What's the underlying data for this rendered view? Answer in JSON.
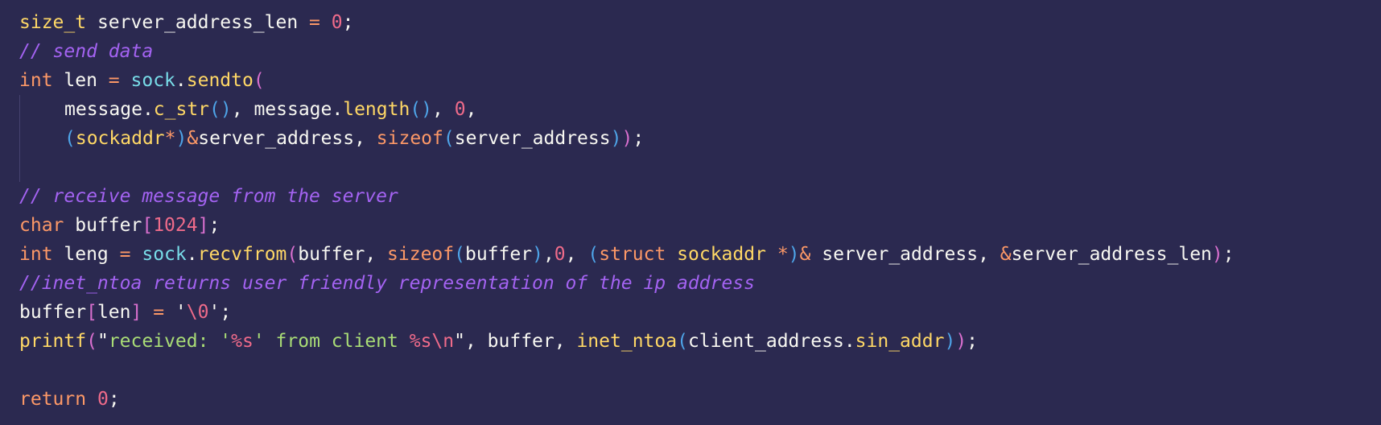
{
  "colors": {
    "background": "#2b2950",
    "default": "#f8f8f2",
    "type": "#ffd866",
    "keyword": "#fc9867",
    "number": "#ef6b8a",
    "comment": "#a463f2",
    "object": "#78dce8",
    "function": "#ffd866",
    "paren_outer": "#d86fce",
    "paren_inner": "#4ea4e8",
    "string": "#a9dc76",
    "escape": "#ef6b8a",
    "indent_guide": "#45426e"
  },
  "lines": [
    {
      "tokens": [
        {
          "t": "size_t",
          "c": "type"
        },
        {
          "t": " server_address_len ",
          "c": "default"
        },
        {
          "t": "=",
          "c": "keyword"
        },
        {
          "t": " ",
          "c": "default"
        },
        {
          "t": "0",
          "c": "number"
        },
        {
          "t": ";",
          "c": "default"
        }
      ]
    },
    {
      "comment": true,
      "tokens": [
        {
          "t": "// send data",
          "c": "comment"
        }
      ]
    },
    {
      "tokens": [
        {
          "t": "int",
          "c": "keyword"
        },
        {
          "t": " len ",
          "c": "default"
        },
        {
          "t": "=",
          "c": "keyword"
        },
        {
          "t": " ",
          "c": "default"
        },
        {
          "t": "sock",
          "c": "object"
        },
        {
          "t": ".",
          "c": "default"
        },
        {
          "t": "sendto",
          "c": "function"
        },
        {
          "t": "(",
          "c": "paren_outer"
        }
      ]
    },
    {
      "indent": true,
      "tokens": [
        {
          "t": "message",
          "c": "default"
        },
        {
          "t": ".",
          "c": "default"
        },
        {
          "t": "c_str",
          "c": "function"
        },
        {
          "t": "()",
          "c": "paren_inner"
        },
        {
          "t": ", message",
          "c": "default"
        },
        {
          "t": ".",
          "c": "default"
        },
        {
          "t": "length",
          "c": "function"
        },
        {
          "t": "()",
          "c": "paren_inner"
        },
        {
          "t": ", ",
          "c": "default"
        },
        {
          "t": "0",
          "c": "number"
        },
        {
          "t": ",",
          "c": "default"
        }
      ]
    },
    {
      "indent": true,
      "tokens": [
        {
          "t": "(",
          "c": "paren_inner"
        },
        {
          "t": "sockaddr",
          "c": "type"
        },
        {
          "t": "*",
          "c": "keyword"
        },
        {
          "t": ")",
          "c": "paren_inner"
        },
        {
          "t": "&",
          "c": "keyword"
        },
        {
          "t": "server_address, ",
          "c": "default"
        },
        {
          "t": "sizeof",
          "c": "keyword"
        },
        {
          "t": "(",
          "c": "paren_inner"
        },
        {
          "t": "server_address",
          "c": "default"
        },
        {
          "t": ")",
          "c": "paren_inner"
        },
        {
          "t": ")",
          "c": "paren_outer"
        },
        {
          "t": ";",
          "c": "default"
        }
      ]
    },
    {
      "indent": true,
      "tokens": []
    },
    {
      "comment": true,
      "tokens": [
        {
          "t": "// receive message from the server",
          "c": "comment"
        }
      ]
    },
    {
      "tokens": [
        {
          "t": "char",
          "c": "keyword"
        },
        {
          "t": " buffer",
          "c": "default"
        },
        {
          "t": "[",
          "c": "paren_outer"
        },
        {
          "t": "1024",
          "c": "number"
        },
        {
          "t": "]",
          "c": "paren_outer"
        },
        {
          "t": ";",
          "c": "default"
        }
      ]
    },
    {
      "tokens": [
        {
          "t": "int",
          "c": "keyword"
        },
        {
          "t": " leng ",
          "c": "default"
        },
        {
          "t": "=",
          "c": "keyword"
        },
        {
          "t": " ",
          "c": "default"
        },
        {
          "t": "sock",
          "c": "object"
        },
        {
          "t": ".",
          "c": "default"
        },
        {
          "t": "recvfrom",
          "c": "function"
        },
        {
          "t": "(",
          "c": "paren_outer"
        },
        {
          "t": "buffer, ",
          "c": "default"
        },
        {
          "t": "sizeof",
          "c": "keyword"
        },
        {
          "t": "(",
          "c": "paren_inner"
        },
        {
          "t": "buffer",
          "c": "default"
        },
        {
          "t": ")",
          "c": "paren_inner"
        },
        {
          "t": ",",
          "c": "default"
        },
        {
          "t": "0",
          "c": "number"
        },
        {
          "t": ", ",
          "c": "default"
        },
        {
          "t": "(",
          "c": "paren_inner"
        },
        {
          "t": "struct",
          "c": "keyword"
        },
        {
          "t": " ",
          "c": "default"
        },
        {
          "t": "sockaddr",
          "c": "type"
        },
        {
          "t": " ",
          "c": "default"
        },
        {
          "t": "*",
          "c": "keyword"
        },
        {
          "t": ")",
          "c": "paren_inner"
        },
        {
          "t": "&",
          "c": "keyword"
        },
        {
          "t": " server_address, ",
          "c": "default"
        },
        {
          "t": "&",
          "c": "keyword"
        },
        {
          "t": "server_address_len",
          "c": "default"
        },
        {
          "t": ")",
          "c": "paren_outer"
        },
        {
          "t": ";",
          "c": "default"
        }
      ]
    },
    {
      "comment": true,
      "tokens": [
        {
          "t": "//inet_ntoa returns user friendly representation of the ip address",
          "c": "comment"
        }
      ]
    },
    {
      "tokens": [
        {
          "t": "buffer",
          "c": "default"
        },
        {
          "t": "[",
          "c": "paren_outer"
        },
        {
          "t": "len",
          "c": "default"
        },
        {
          "t": "]",
          "c": "paren_outer"
        },
        {
          "t": " ",
          "c": "default"
        },
        {
          "t": "=",
          "c": "keyword"
        },
        {
          "t": " '",
          "c": "default"
        },
        {
          "t": "\\0",
          "c": "escape"
        },
        {
          "t": "';",
          "c": "default"
        }
      ]
    },
    {
      "tokens": [
        {
          "t": "printf",
          "c": "function"
        },
        {
          "t": "(",
          "c": "paren_outer"
        },
        {
          "t": "\"",
          "c": "default"
        },
        {
          "t": "received: '",
          "c": "string"
        },
        {
          "t": "%s",
          "c": "escape"
        },
        {
          "t": "' from client ",
          "c": "string"
        },
        {
          "t": "%s\\n",
          "c": "escape"
        },
        {
          "t": "\"",
          "c": "default"
        },
        {
          "t": ", buffer, ",
          "c": "default"
        },
        {
          "t": "inet_ntoa",
          "c": "function"
        },
        {
          "t": "(",
          "c": "paren_inner"
        },
        {
          "t": "client_address",
          "c": "default"
        },
        {
          "t": ".",
          "c": "default"
        },
        {
          "t": "sin_addr",
          "c": "function"
        },
        {
          "t": ")",
          "c": "paren_inner"
        },
        {
          "t": ")",
          "c": "paren_outer"
        },
        {
          "t": ";",
          "c": "default"
        }
      ]
    },
    {
      "tokens": []
    },
    {
      "tokens": [
        {
          "t": "return",
          "c": "keyword"
        },
        {
          "t": " ",
          "c": "default"
        },
        {
          "t": "0",
          "c": "number"
        },
        {
          "t": ";",
          "c": "default"
        }
      ]
    }
  ]
}
